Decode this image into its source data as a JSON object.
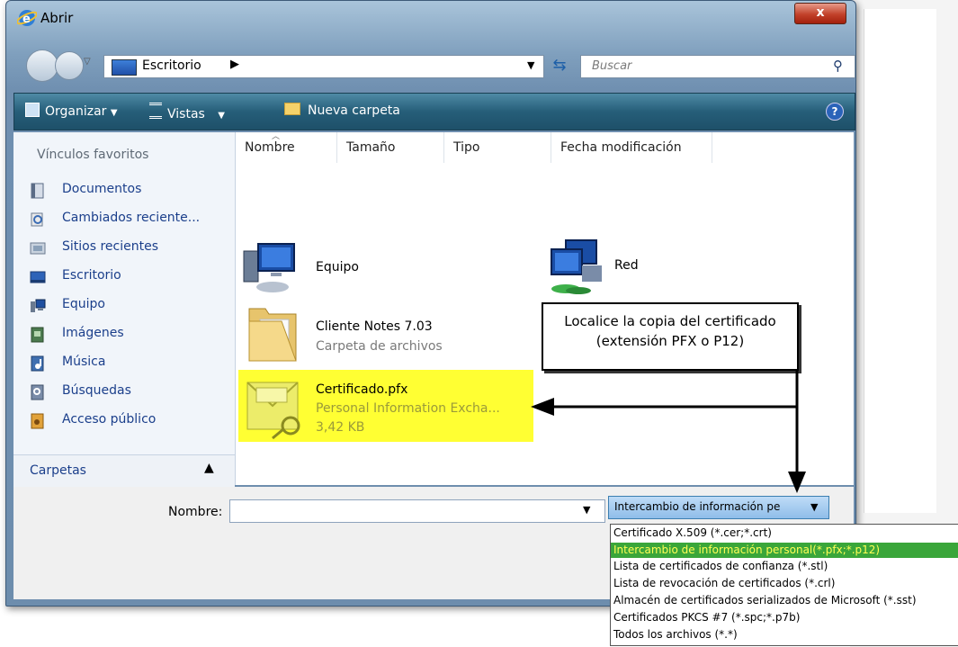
{
  "window": {
    "title": "Abrir",
    "close_label": "x"
  },
  "address": {
    "location": "Escritorio",
    "search_placeholder": "Buscar"
  },
  "toolbar": {
    "organize": "Organizar",
    "views": "Vistas",
    "new_folder": "Nueva carpeta",
    "help": "?"
  },
  "sidebar": {
    "heading": "Vínculos favoritos",
    "items": [
      {
        "label": "Documentos",
        "icon": "documents-icon"
      },
      {
        "label": "Cambiados reciente...",
        "icon": "recent-changes-icon"
      },
      {
        "label": "Sitios recientes",
        "icon": "recent-places-icon"
      },
      {
        "label": "Escritorio",
        "icon": "desktop-icon"
      },
      {
        "label": "Equipo",
        "icon": "computer-icon"
      },
      {
        "label": "Imágenes",
        "icon": "pictures-icon"
      },
      {
        "label": "Música",
        "icon": "music-icon"
      },
      {
        "label": "Búsquedas",
        "icon": "searches-icon"
      },
      {
        "label": "Acceso público",
        "icon": "public-icon"
      }
    ],
    "folders_label": "Carpetas"
  },
  "columns": [
    "Nombre",
    "Tamaño",
    "Tipo",
    "Fecha modificación"
  ],
  "files": {
    "equipo": {
      "name": "Equipo"
    },
    "red": {
      "name": "Red"
    },
    "folder": {
      "name": "Cliente Notes 7.03",
      "type": "Carpeta de archivos"
    },
    "cert": {
      "name": "Certificado.pfx",
      "type": "Personal Information Excha...",
      "size": "3,42 KB"
    }
  },
  "bottom": {
    "name_label": "Nombre:",
    "name_value": "",
    "filter_selected": "Intercambio de información pe",
    "filter_options": [
      "Certificado X.509 (*.cer;*.crt)",
      "Intercambio de información personal(*.pfx;*.p12)",
      "Lista de certificados de confianza (*.stl)",
      "Lista de revocación de certificados (*.crl)",
      "Almacén de certificados serializados de Microsoft (*.sst)",
      "Certificados PKCS #7 (*.spc;*.p7b)",
      "Todos los archivos (*.*)"
    ]
  },
  "annotation": {
    "line1": "Localice la copia del certificado",
    "line2": "(extensión PFX o P12)"
  },
  "colors": {
    "highlight": "#ffff33",
    "selected_option_bg": "#3aa63a",
    "selected_option_text": "#ffff55",
    "toolbar": "#265e79"
  }
}
